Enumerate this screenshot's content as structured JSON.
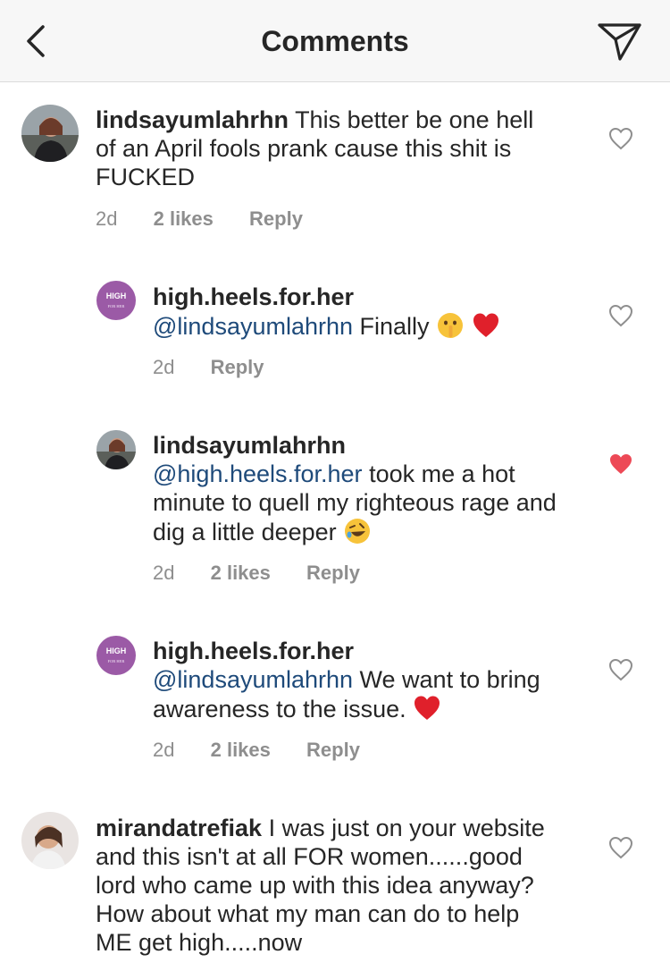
{
  "header": {
    "title": "Comments"
  },
  "comments": [
    {
      "username": "lindsayumlahrhn",
      "mention": "",
      "text": "This better be one hell of an April fools prank cause this shit is FUCKED",
      "time": "2d",
      "likes": "2 likes",
      "reply": "Reply",
      "liked": false
    },
    {
      "username": "high.heels.for.her",
      "mention": "@lindsayumlahrhn",
      "text": "Finally",
      "time": "2d",
      "likes": "",
      "reply": "Reply",
      "liked": false,
      "emojis": [
        "shushing-face-emoji",
        "red-heart-emoji"
      ]
    },
    {
      "username": "lindsayumlahrhn",
      "mention": "@high.heels.for.her",
      "text": "took me a hot minute to quell my righteous rage and dig a little deeper",
      "time": "2d",
      "likes": "2 likes",
      "reply": "Reply",
      "liked": true,
      "emojis": [
        "rolling-laughing-emoji"
      ]
    },
    {
      "username": "high.heels.for.her",
      "mention": "@lindsayumlahrhn",
      "text": "We want to bring awareness to the issue.",
      "time": "2d",
      "likes": "2 likes",
      "reply": "Reply",
      "liked": false,
      "emojis": [
        "red-heart-emoji"
      ]
    },
    {
      "username": "mirandatrefiak",
      "mention": "",
      "text": "I was just on your website and this isn't at all FOR women......good lord who came up with this idea anyway?  How about what my man can do to help ME get high.....now",
      "time": "",
      "likes": "",
      "reply": "",
      "liked": false
    }
  ],
  "avatars": {
    "brand_text": "HIGH",
    "brand_sub": "FOR HER"
  },
  "colors": {
    "liked_heart": "#ed4956",
    "mention": "#1e4a7a",
    "meta": "#8e8e8e"
  }
}
